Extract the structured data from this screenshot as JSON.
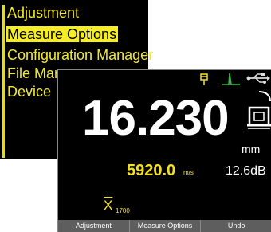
{
  "menu": {
    "items": [
      {
        "label": "Adjustment"
      },
      {
        "label": "Measure Options",
        "selected": true
      },
      {
        "label": "Configuration Manager"
      },
      {
        "label": "File Manager"
      },
      {
        "label": "Device"
      }
    ]
  },
  "status_icons": [
    "flag-icon",
    "waveform-icon",
    "usb-icon",
    "probe-icon"
  ],
  "measurement": {
    "value": "16.230",
    "unit": "mm",
    "velocity": "5920.0",
    "velocity_unit": "m/s",
    "gain": "12.6dB",
    "xbar_symbol": "X",
    "xbar_subscript": "1700"
  },
  "softkeys": [
    "Adjustment",
    "Measure  Options",
    "Undo"
  ],
  "colors": {
    "accent": "#f4e020",
    "softkey_bar": "#5e5e5e",
    "background": "#000000"
  }
}
